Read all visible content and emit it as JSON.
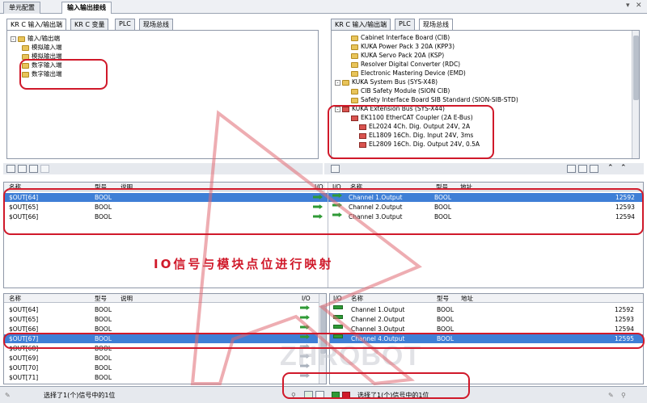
{
  "doc_tabs": [
    {
      "label": "单元配置",
      "active": false
    },
    {
      "label": "输入输出接线",
      "active": true
    }
  ],
  "left_tabs": [
    "KR C 输入/输出端",
    "KR C 变量",
    "PLC",
    "现场总线"
  ],
  "right_tabs": [
    "KR C 输入/输出端",
    "PLC",
    "现场总线"
  ],
  "left_tree": [
    {
      "label": "输入/输出端",
      "level": 0
    },
    {
      "label": "模拟输入端",
      "level": 1
    },
    {
      "label": "模拟输出端",
      "level": 1
    },
    {
      "label": "数字输入端",
      "level": 1
    },
    {
      "label": "数字输出端",
      "level": 1
    }
  ],
  "right_tree": [
    {
      "label": "Cabinet Interface Board (CIB)",
      "level": 1,
      "icon": "folder"
    },
    {
      "label": "KUKA Power Pack 3 20A (KPP3)",
      "level": 1,
      "icon": "folder"
    },
    {
      "label": "KUKA Servo Pack 20A (KSP)",
      "level": 1,
      "icon": "folder"
    },
    {
      "label": "Resolver Digital Converter (RDC)",
      "level": 1,
      "icon": "folder"
    },
    {
      "label": "Electronic Mastering Device (EMD)",
      "level": 1,
      "icon": "folder"
    },
    {
      "label": "KUKA System Bus (SYS-X48)",
      "level": 0,
      "icon": "folder"
    },
    {
      "label": "CIB Safety Module (SION CIB)",
      "level": 1,
      "icon": "folder"
    },
    {
      "label": "Safety Interface Board SIB Standard (SION-SIB-STD)",
      "level": 1,
      "icon": "folder"
    },
    {
      "label": "KUKA Extension Bus (SYS-X44)",
      "level": 0,
      "icon": "card"
    },
    {
      "label": "EK1100 EtherCAT Coupler (2A E-Bus)",
      "level": 1,
      "icon": "card"
    },
    {
      "label": "EL2024 4Ch. Dig. Output 24V, 2A",
      "level": 2,
      "icon": "card"
    },
    {
      "label": "EL1809 16Ch. Dig. Input 24V, 3ms",
      "level": 2,
      "icon": "card"
    },
    {
      "label": "EL2809 16Ch. Dig. Output 24V, 0.5A",
      "level": 2,
      "icon": "card"
    }
  ],
  "upper_grid": {
    "left_headers": [
      "名称",
      "型号",
      "说明",
      "I/O"
    ],
    "right_headers": [
      "I/O",
      "名称",
      "型号",
      "地址"
    ],
    "left_rows": [
      {
        "name": "$OUT[64]",
        "type": "BOOL",
        "desc": ""
      },
      {
        "name": "$OUT[65]",
        "type": "BOOL",
        "desc": ""
      },
      {
        "name": "$OUT[66]",
        "type": "BOOL",
        "desc": ""
      }
    ],
    "right_rows": [
      {
        "name": "Channel 1.Output",
        "type": "BOOL",
        "addr": "12592"
      },
      {
        "name": "Channel 2.Output",
        "type": "BOOL",
        "addr": "12593"
      },
      {
        "name": "Channel 3.Output",
        "type": "BOOL",
        "addr": "12594"
      }
    ]
  },
  "annotation": "IO信号与模块点位进行映射",
  "lower_grid": {
    "left_headers": [
      "名称",
      "型号",
      "说明",
      "I/O"
    ],
    "right_headers": [
      "I/O",
      "名称",
      "型号",
      "地址"
    ],
    "left_rows": [
      {
        "name": "$OUT[64]",
        "type": "BOOL"
      },
      {
        "name": "$OUT[65]",
        "type": "BOOL"
      },
      {
        "name": "$OUT[66]",
        "type": "BOOL"
      },
      {
        "name": "$OUT[67]",
        "type": "BOOL"
      },
      {
        "name": "$OUT[68]",
        "type": "BOOL"
      },
      {
        "name": "$OUT[69]",
        "type": "BOOL"
      },
      {
        "name": "$OUT[70]",
        "type": "BOOL"
      },
      {
        "name": "$OUT[71]",
        "type": "BOOL"
      }
    ],
    "right_rows": [
      {
        "name": "Channel 1.Output",
        "type": "BOOL",
        "addr": "12592"
      },
      {
        "name": "Channel 2.Output",
        "type": "BOOL",
        "addr": "12593"
      },
      {
        "name": "Channel 3.Output",
        "type": "BOOL",
        "addr": "12594"
      },
      {
        "name": "Channel 4.Output",
        "type": "BOOL",
        "addr": "12595"
      }
    ]
  },
  "status_left": "选择了1(个)信号中的1位",
  "status_right": "选择了1(个)信号中的1位",
  "watermark": "ZHROBOT",
  "colors": {
    "selection": "#3f7fd6",
    "annotation": "#d0192a",
    "link_arrow": "#2f9a36"
  }
}
